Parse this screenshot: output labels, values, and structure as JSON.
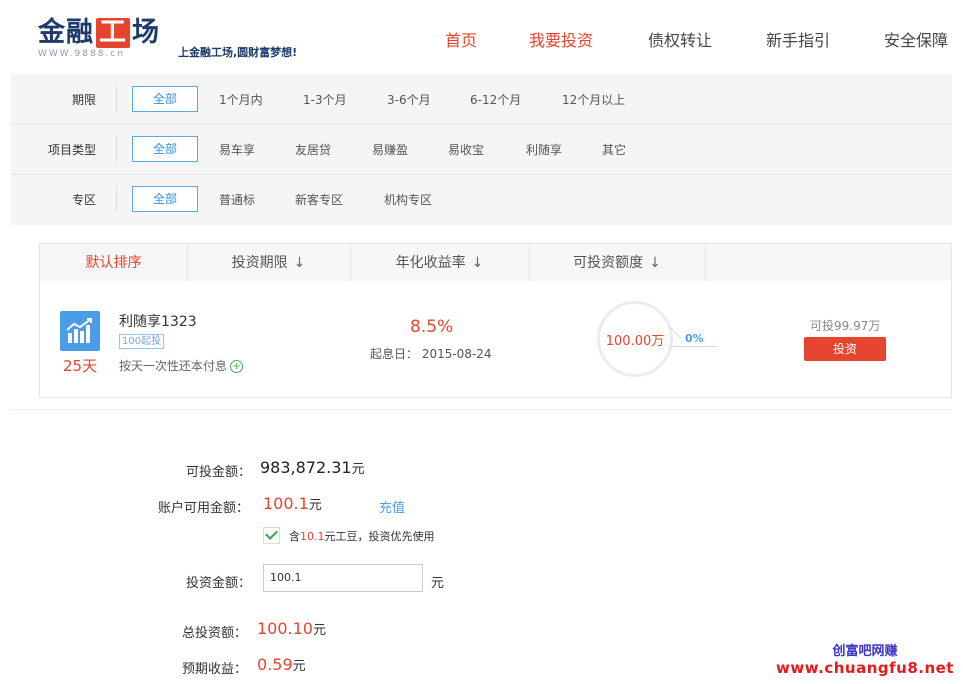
{
  "header": {
    "logo_main_a": "金融",
    "logo_main_box": "工",
    "logo_main_b": "场",
    "logo_url": "WWW.9888.cn",
    "logo_slogan": "上金融工场,圆财富梦想!",
    "nav": [
      {
        "label": "首页",
        "active": true
      },
      {
        "label": "我要投资",
        "active": true
      },
      {
        "label": "债权转让",
        "active": false
      },
      {
        "label": "新手指引",
        "active": false
      },
      {
        "label": "安全保障",
        "active": false
      }
    ]
  },
  "filters": {
    "term": {
      "label": "期限",
      "options": [
        "全部",
        "1个月内",
        "1-3个月",
        "3-6个月",
        "6-12个月",
        "12个月以上"
      ]
    },
    "type": {
      "label": "项目类型",
      "options": [
        "全部",
        "易车享",
        "友居贷",
        "易赚盈",
        "易收宝",
        "利随享",
        "其它"
      ]
    },
    "zone": {
      "label": "专区",
      "options": [
        "全部",
        "普通标",
        "新客专区",
        "机构专区"
      ]
    }
  },
  "sortbar": {
    "items": [
      "默认排序",
      "投资期限",
      "年化收益率",
      "可投资额度"
    ],
    "arrow": "↓"
  },
  "product": {
    "icon": "bar-chart-icon",
    "days": "25天",
    "name": "利随享1323",
    "tag": "100起投",
    "repay": "按天一次性还本付息",
    "plus": "+",
    "rate": "8.5%",
    "start_date": "起息日：  2015-08-24",
    "circle_amount": "100.00万",
    "progress_pct": "0%",
    "progress_value": 0,
    "available": "可投99.97万",
    "invest_label": "投资"
  },
  "form": {
    "investable_label": "可投金额：",
    "investable_value": "983,872.31",
    "investable_unit": "元",
    "balance_label": "账户可用金额：",
    "balance_value": "100.1",
    "balance_unit": "元",
    "recharge": "充值",
    "bean_prefix": "含",
    "bean_amount": "10.1",
    "bean_suffix": "元工豆，投资优先使用",
    "amount_label": "投资金额：",
    "amount_value": "100.1",
    "amount_unit": "元",
    "total_label": "总投资额：",
    "total_value": "100.10",
    "total_unit": "元",
    "expected_label": "预期收益：",
    "expected_value": "0.59",
    "expected_unit": "元"
  },
  "watermark": {
    "line1": "创富吧网赚",
    "line2": "www.chuangfu8.net"
  },
  "colors": {
    "accent_red": "#e5452f",
    "link_blue": "#4b9ee6",
    "logo_navy": "#1d3b6b"
  }
}
